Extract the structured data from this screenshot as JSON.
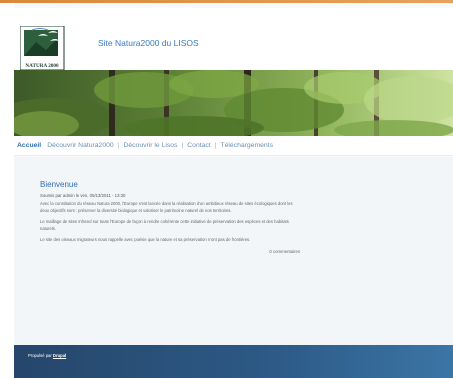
{
  "site": {
    "title": "Site Natura2000 du LISOS",
    "logo_text": "NATURA 2000"
  },
  "nav": {
    "items": [
      {
        "label": "Accueil",
        "active": true
      },
      {
        "label": "Découvrir Natura2000"
      },
      {
        "label": "Découvrir le Lisos"
      },
      {
        "label": "Contact"
      },
      {
        "label": "Téléchargements"
      }
    ],
    "separator": "|"
  },
  "article": {
    "title": "Bienvenue",
    "meta": "Soumis par admin le ven, 05/13/2011 - 13:30",
    "paragraphs": [
      "Avec la constitution du réseau Natura 2000, l'Europe s'est lancée dans la réalisation d'un ambitieux réseau de sites écologiques dont les deux objectifs sont : préserver la diversité biologique et valoriser le patrimoine naturel de nos territoires.",
      "Le maillage de sites s'étend sur toute l'Europe de façon à rendre cohérente cette initiative de préservation des espèces et des habitats naturels.",
      "Le site des oiseaux migrateurs nous rappelle avec poésie que la nature et sa préservation n'ont pas de frontières."
    ],
    "comments_label": "0 commentaires"
  },
  "footer": {
    "prefix": "Propulsé par",
    "link": "Drupal"
  },
  "colors": {
    "accent": "#2f6fb0",
    "footer": "#2d5a87",
    "top_stripe": "#d9893a"
  }
}
